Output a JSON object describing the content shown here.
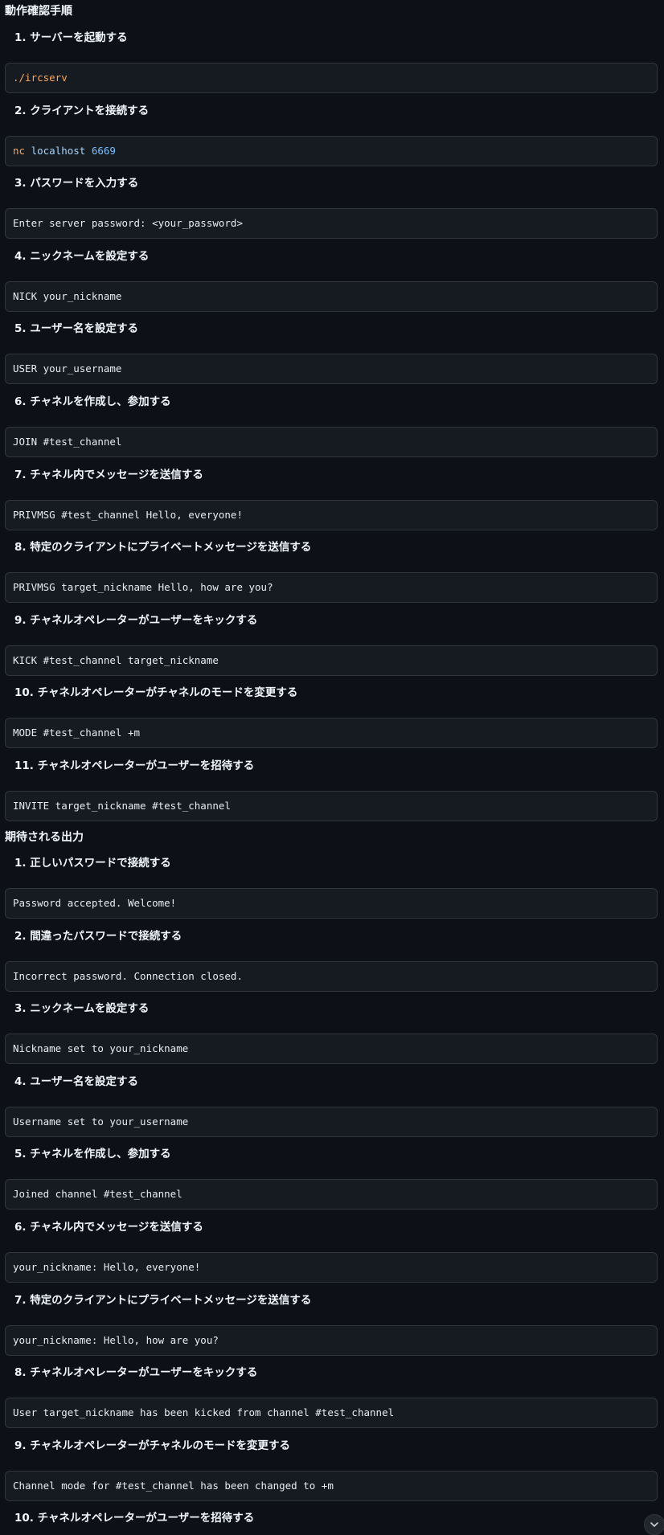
{
  "procedure": {
    "heading": "動作確認手順",
    "steps": [
      {
        "title": "1. サーバーを起動する",
        "tokens": [
          {
            "text": "./ircserv",
            "color": "#ffa657"
          }
        ]
      },
      {
        "title": "2. クライアントを接続する",
        "tokens": [
          {
            "text": "nc",
            "color": "#ffa657"
          },
          {
            "text": " localhost ",
            "color": "#a5d6ff"
          },
          {
            "text": "6669",
            "color": "#79c0ff"
          }
        ]
      },
      {
        "title": "3. パスワードを入力する",
        "code": "Enter server password: <your_password>"
      },
      {
        "title": "4. ニックネームを設定する",
        "code": "NICK your_nickname"
      },
      {
        "title": "5. ユーザー名を設定する",
        "code": "USER your_username"
      },
      {
        "title": "6. チャネルを作成し、参加する",
        "code": "JOIN #test_channel"
      },
      {
        "title": "7. チャネル内でメッセージを送信する",
        "code": "PRIVMSG #test_channel Hello, everyone!"
      },
      {
        "title": "8. 特定のクライアントにプライベートメッセージを送信する",
        "code": "PRIVMSG target_nickname Hello, how are you?"
      },
      {
        "title": "9. チャネルオペレーターがユーザーをキックする",
        "code": "KICK #test_channel target_nickname"
      },
      {
        "title": "10. チャネルオペレーターがチャネルのモードを変更する",
        "code": "MODE #test_channel +m"
      },
      {
        "title": "11. チャネルオペレーターがユーザーを招待する",
        "code": "INVITE target_nickname #test_channel"
      }
    ]
  },
  "expected": {
    "heading": "期待される出力",
    "steps": [
      {
        "title": "1. 正しいパスワードで接続する",
        "code": "Password accepted. Welcome!"
      },
      {
        "title": "2. 間違ったパスワードで接続する",
        "code": "Incorrect password. Connection closed."
      },
      {
        "title": "3. ニックネームを設定する",
        "code": "Nickname set to your_nickname"
      },
      {
        "title": "4. ユーザー名を設定する",
        "code": "Username set to your_username"
      },
      {
        "title": "5. チャネルを作成し、参加する",
        "code": "Joined channel #test_channel"
      },
      {
        "title": "6. チャネル内でメッセージを送信する",
        "code": "your_nickname: Hello, everyone!"
      },
      {
        "title": "7. 特定のクライアントにプライベートメッセージを送信する",
        "code": "your_nickname: Hello, how are you?"
      },
      {
        "title": "8. チャネルオペレーターがユーザーをキックする",
        "code": "User target_nickname has been kicked from channel #test_channel"
      },
      {
        "title": "9. チャネルオペレーターがチャネルのモードを変更する",
        "code": "Channel mode for #test_channel has been changed to +m"
      },
      {
        "title": "10. チャネルオペレーターがユーザーを招待する"
      }
    ]
  },
  "scroll_button": {
    "icon": "chevron-down-icon"
  }
}
